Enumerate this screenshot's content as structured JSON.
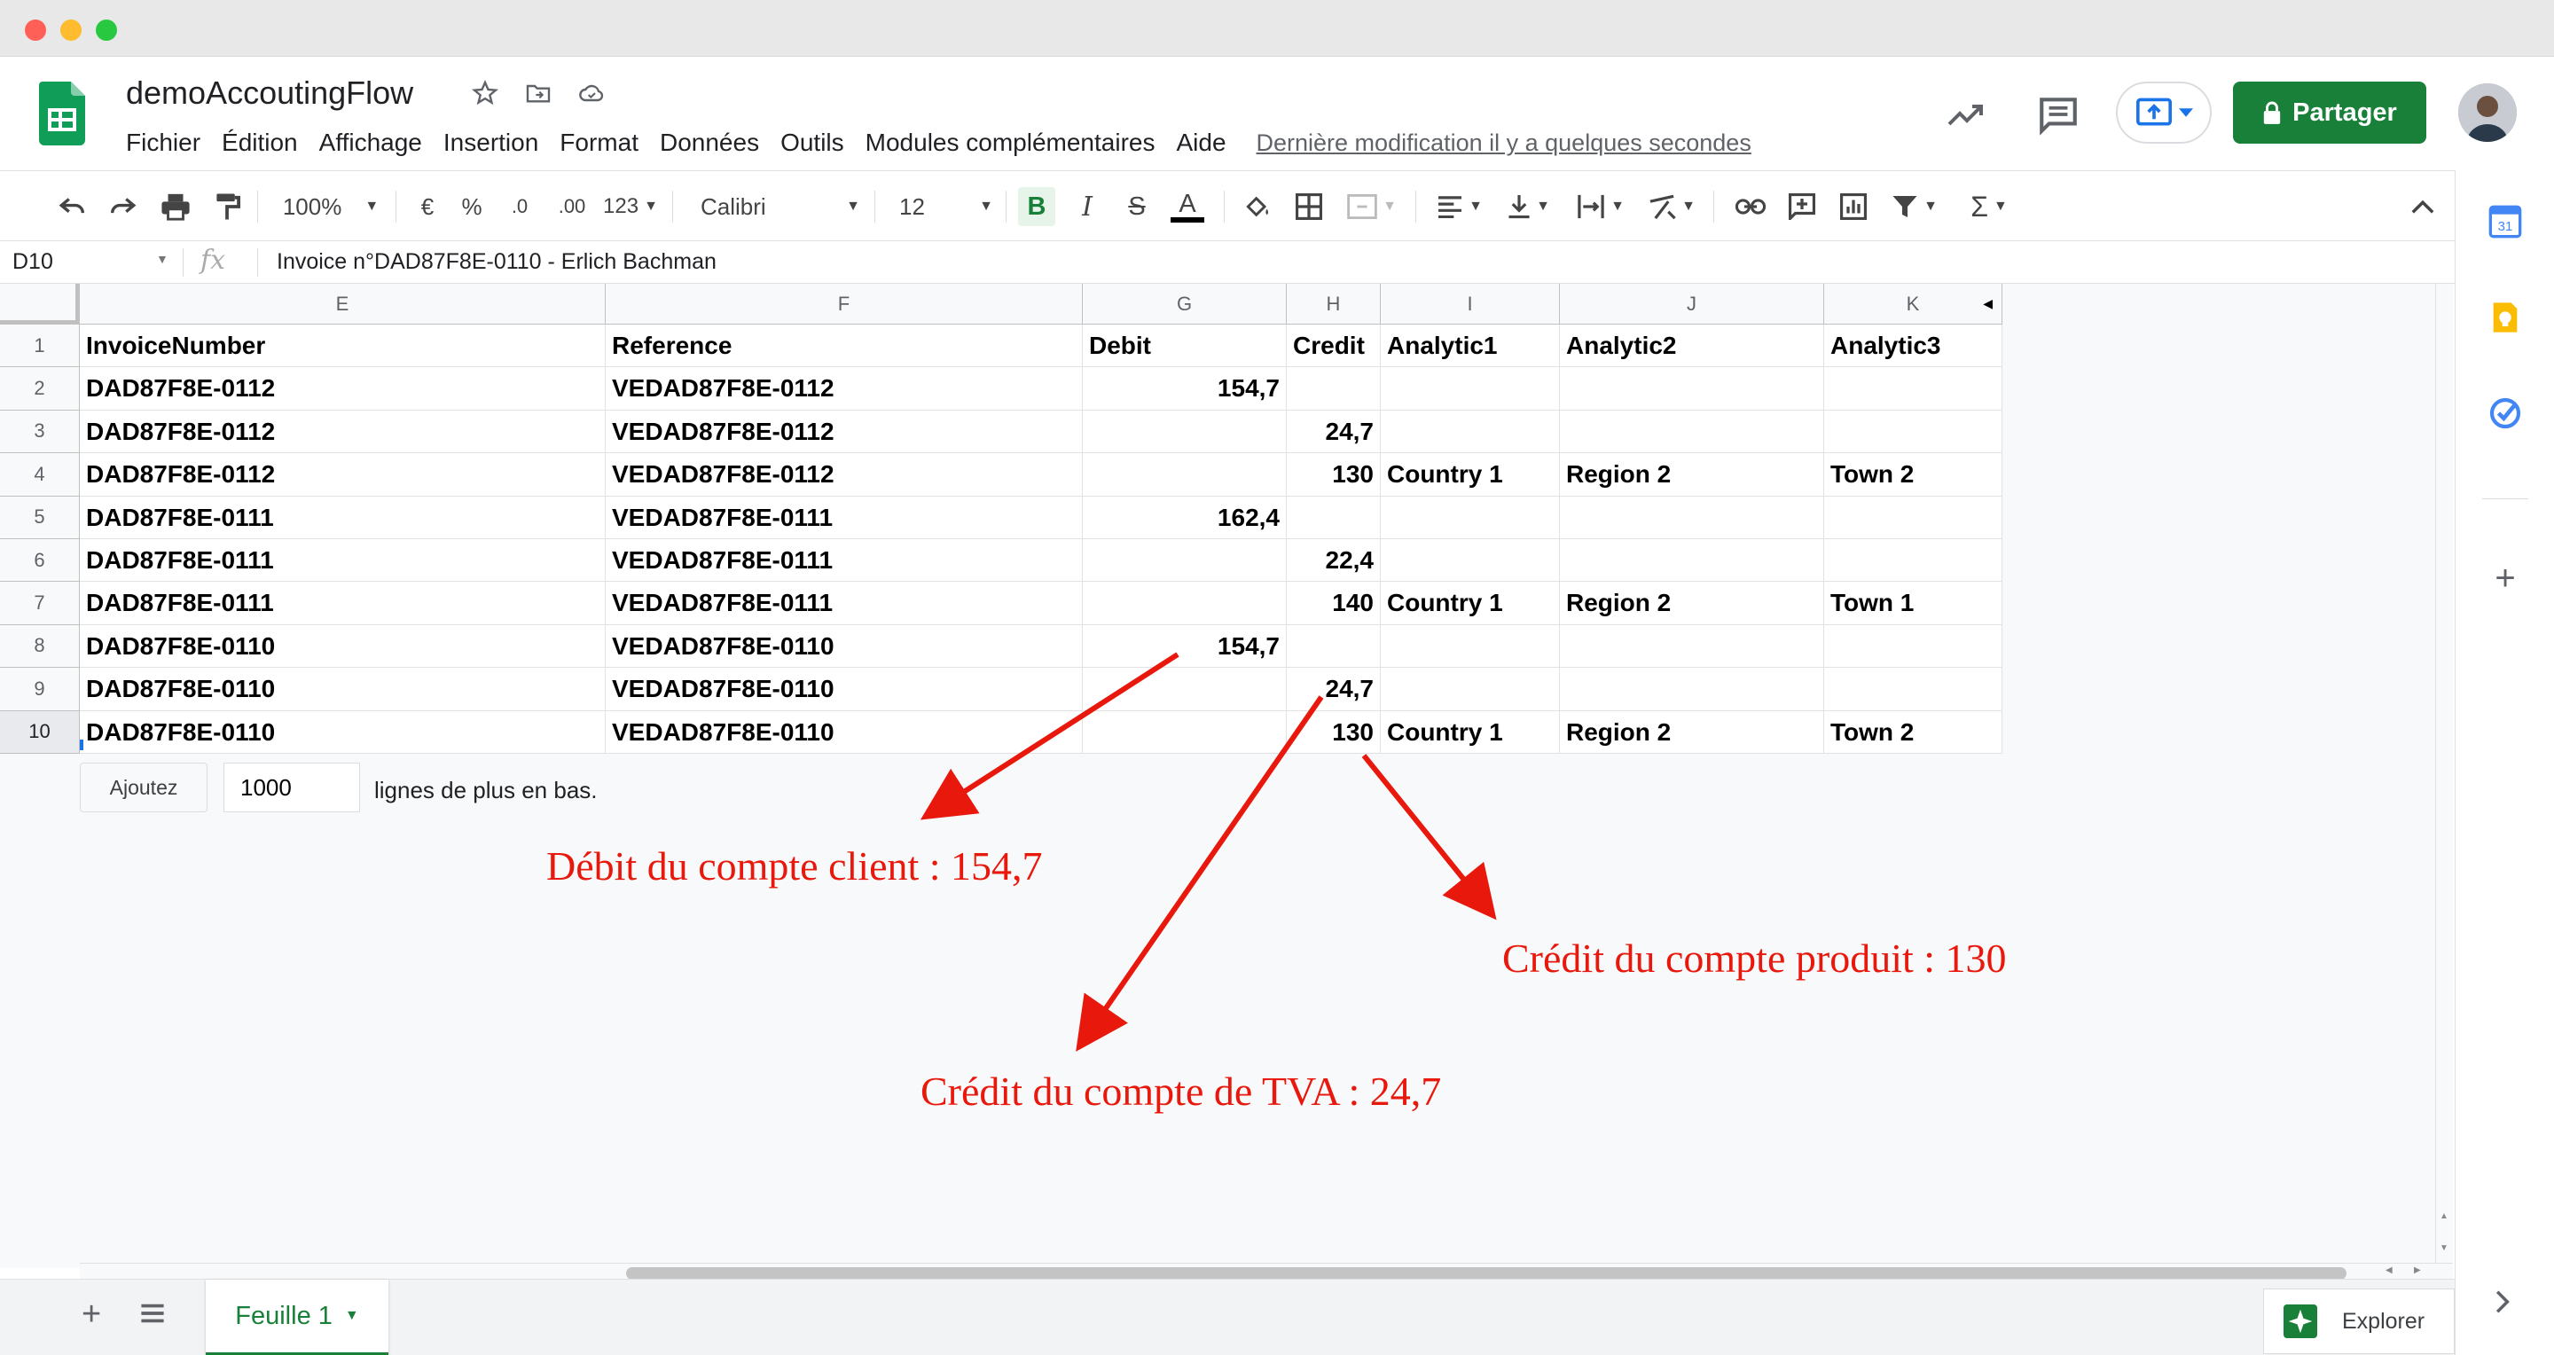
{
  "window": {
    "title": "demoAccoutingFlow"
  },
  "menu": [
    "Fichier",
    "Édition",
    "Affichage",
    "Insertion",
    "Format",
    "Données",
    "Outils",
    "Modules complémentaires",
    "Aide"
  ],
  "last_modified": "Dernière modification il y a quelques secondes",
  "share_label": "Partager",
  "toolbar": {
    "zoom": "100%",
    "currency": "€",
    "percent": "%",
    "dec_minus": ".0",
    "dec_plus": ".00",
    "more_formats": "123",
    "font": "Calibri",
    "font_size": "12",
    "bold": "B",
    "italic": "I",
    "strike": "S",
    "text_color": "A"
  },
  "formula_bar": {
    "cell_ref": "D10",
    "fx": "fx",
    "content": "Invoice n°DAD87F8E-0110 - Erlich  Bachman"
  },
  "grid": {
    "columns": [
      "E",
      "F",
      "G",
      "H",
      "I",
      "J",
      "K"
    ],
    "row_numbers": [
      "1",
      "2",
      "3",
      "4",
      "5",
      "6",
      "7",
      "8",
      "9",
      "10"
    ],
    "rows": [
      [
        "InvoiceNumber",
        "Reference",
        "Debit",
        "Credit",
        "Analytic1",
        "Analytic2",
        "Analytic3"
      ],
      [
        "DAD87F8E-0112",
        "VEDAD87F8E-0112",
        "154,7",
        "",
        "",
        "",
        ""
      ],
      [
        "DAD87F8E-0112",
        "VEDAD87F8E-0112",
        "",
        "24,7",
        "",
        "",
        ""
      ],
      [
        "DAD87F8E-0112",
        "VEDAD87F8E-0112",
        "",
        "130",
        "Country 1",
        "Region 2",
        "Town 2"
      ],
      [
        "DAD87F8E-0111",
        "VEDAD87F8E-0111",
        "162,4",
        "",
        "",
        "",
        ""
      ],
      [
        "DAD87F8E-0111",
        "VEDAD87F8E-0111",
        "",
        "22,4",
        "",
        "",
        ""
      ],
      [
        "DAD87F8E-0111",
        "VEDAD87F8E-0111",
        "",
        "140",
        "Country 1",
        "Region 2",
        "Town 1"
      ],
      [
        "DAD87F8E-0110",
        "VEDAD87F8E-0110",
        "154,7",
        "",
        "",
        "",
        ""
      ],
      [
        "DAD87F8E-0110",
        "VEDAD87F8E-0110",
        "",
        "24,7",
        "",
        "",
        ""
      ],
      [
        "DAD87F8E-0110",
        "VEDAD87F8E-0110",
        "",
        "130",
        "Country 1",
        "Region 2",
        "Town 2"
      ]
    ]
  },
  "add_rows": {
    "button": "Ajoutez",
    "value": "1000",
    "suffix": "lignes de plus en bas."
  },
  "annotations": {
    "debit_client": "Débit du compte client : 154,7",
    "credit_produit": "Crédit du compte produit : 130",
    "credit_tva": "Crédit du compte de TVA : 24,7",
    "color": "#e8180c"
  },
  "sheet_tabs": [
    "Feuille 1"
  ],
  "explore_label": "Explorer",
  "colors": {
    "accent_green": "#188038",
    "selection_blue": "#1a73e8",
    "side_calendar_day": "31"
  }
}
